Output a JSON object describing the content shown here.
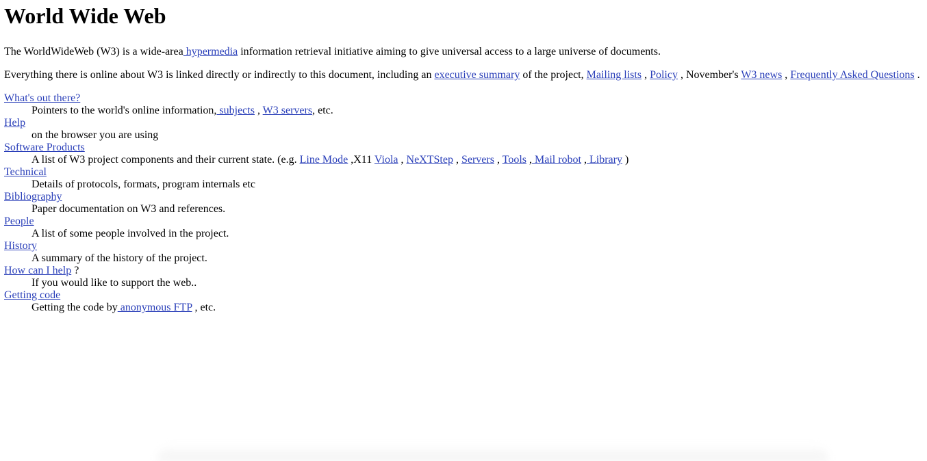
{
  "title": "World Wide Web",
  "intro": {
    "before": "The WorldWideWeb (W3) is a wide-area",
    "hypermedia_link": " hypermedia",
    "after": " information retrieval initiative aiming to give universal access to a large universe of documents."
  },
  "everything": {
    "before": "Everything there is online about W3 is linked directly or indirectly to this document, including an ",
    "exec_summary_link": "executive summary",
    "mid1": " of the project, ",
    "mailing_lists_link": "Mailing lists",
    "sep1": " , ",
    "policy_link": "Policy",
    "mid2": " , November's ",
    "w3_news_link": "W3 news",
    "sep2": " , ",
    "faq_link": "Frequently Asked Questions",
    "end": " ."
  },
  "items": {
    "whats_out": {
      "link": "What's out there?",
      "desc_before": "Pointers to the world's online information,",
      "subjects_link": " subjects",
      "sep": " , ",
      "servers_link": "W3 servers",
      "desc_after": ", etc."
    },
    "help": {
      "link": "Help",
      "desc": "on the browser you are using"
    },
    "software": {
      "link": "Software Products",
      "desc_before": "A list of W3 project components and their current state. (e.g. ",
      "line_mode_link": "Line Mode",
      "x11_text": " ,X11 ",
      "viola_link": "Viola",
      "sep1": " , ",
      "nextstep_link": "NeXTStep",
      "sep2": " , ",
      "servers_link": "Servers",
      "sep3": " , ",
      "tools_link": "Tools",
      "sep4": " ,",
      "mail_robot_link": " Mail robot",
      "sep5": " ,",
      "library_link": " Library",
      "desc_after": " )"
    },
    "technical": {
      "link": "Technical",
      "desc": "Details of protocols, formats, program internals etc"
    },
    "bibliography": {
      "link": "Bibliography",
      "desc": "Paper documentation on W3 and references."
    },
    "people": {
      "link": "People",
      "desc": "A list of some people involved in the project."
    },
    "history": {
      "link": "History",
      "desc": "A summary of the history of the project."
    },
    "how_help": {
      "link": "How can I help",
      "suffix": " ?",
      "desc": "If you would like to support the web.."
    },
    "getting_code": {
      "link": "Getting code",
      "desc_before": "Getting the code by",
      "ftp_link": " anonymous FTP",
      "desc_after": " , etc."
    }
  },
  "colors": {
    "link": "#2a3fb9",
    "text": "#000000",
    "background": "#ffffff"
  }
}
